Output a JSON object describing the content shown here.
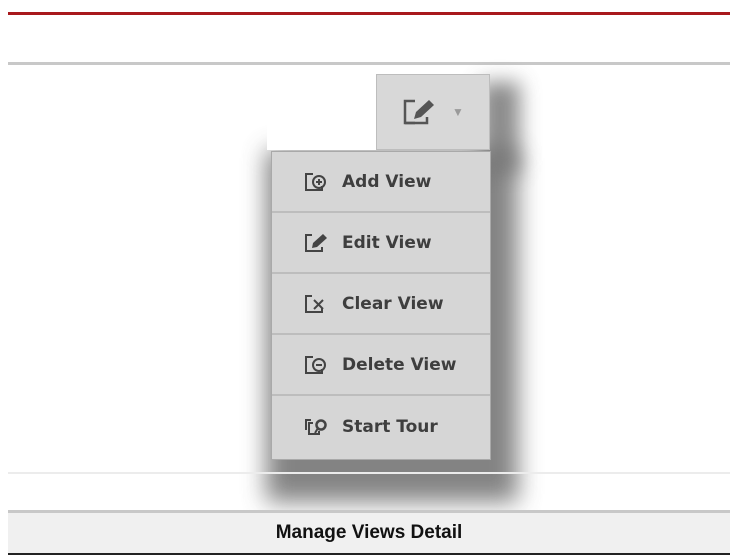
{
  "toolbar": {
    "trigger_icon": "edit-view-icon",
    "caret_icon": "caret-down-icon",
    "caret_glyph": "▼"
  },
  "menu": {
    "items": [
      {
        "label": "Add View",
        "icon": "add-view-icon"
      },
      {
        "label": "Edit View",
        "icon": "edit-view-icon"
      },
      {
        "label": "Clear View",
        "icon": "clear-view-icon"
      },
      {
        "label": "Delete View",
        "icon": "delete-view-icon"
      },
      {
        "label": "Start Tour",
        "icon": "start-tour-icon"
      }
    ]
  },
  "caption": {
    "text": "Manage Views Detail"
  },
  "colors": {
    "accent_rule": "#a8181c",
    "menu_bg": "#d6d6d6",
    "menu_text": "#3e3e3e",
    "caption_bg": "#f0f0f0"
  }
}
